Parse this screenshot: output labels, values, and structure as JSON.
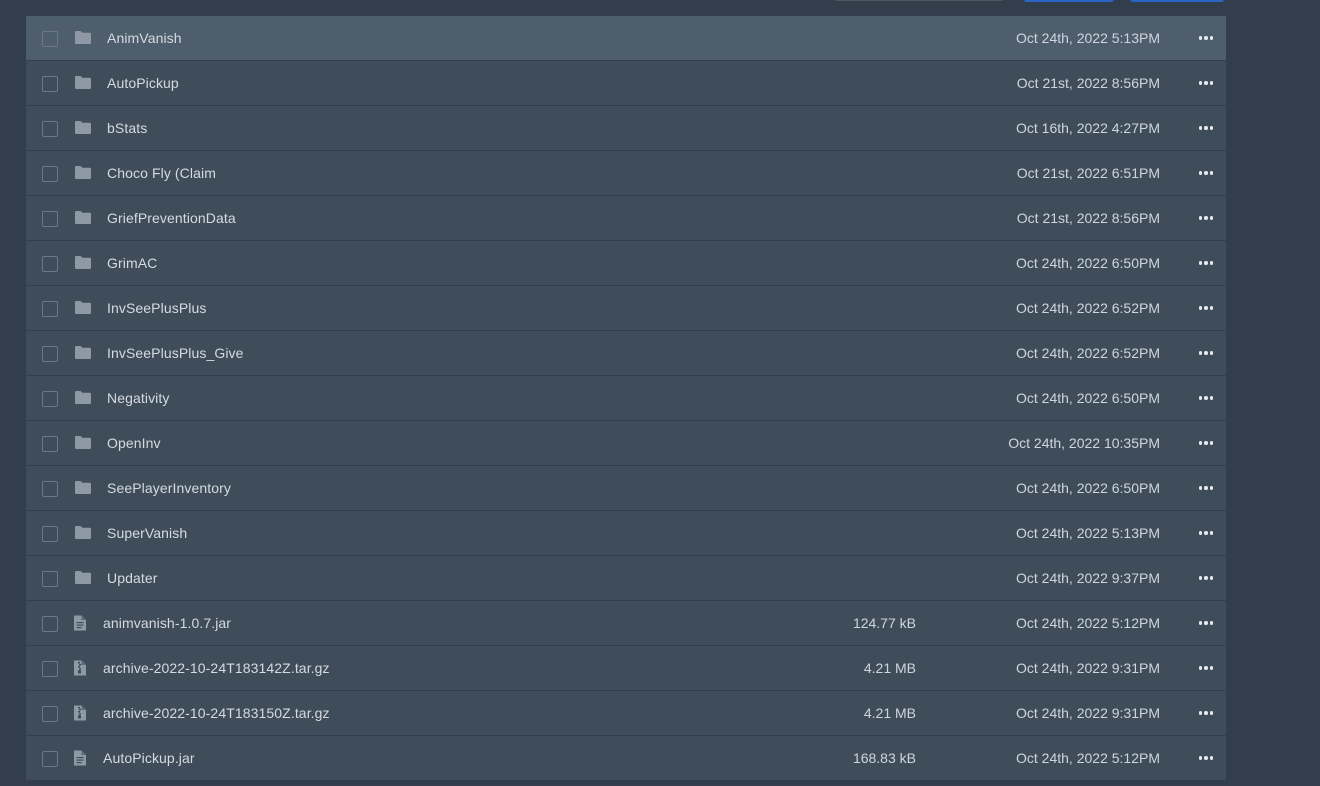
{
  "toolbar": {
    "primary_buttons": 2
  },
  "files": [
    {
      "type": "folder",
      "name": "AnimVanish",
      "size": "",
      "date": "Oct 24th, 2022 5:13PM"
    },
    {
      "type": "folder",
      "name": "AutoPickup",
      "size": "",
      "date": "Oct 21st, 2022 8:56PM"
    },
    {
      "type": "folder",
      "name": "bStats",
      "size": "",
      "date": "Oct 16th, 2022 4:27PM"
    },
    {
      "type": "folder",
      "name": "Choco Fly (Claim",
      "size": "",
      "date": "Oct 21st, 2022 6:51PM"
    },
    {
      "type": "folder",
      "name": "GriefPreventionData",
      "size": "",
      "date": "Oct 21st, 2022 8:56PM"
    },
    {
      "type": "folder",
      "name": "GrimAC",
      "size": "",
      "date": "Oct 24th, 2022 6:50PM"
    },
    {
      "type": "folder",
      "name": "InvSeePlusPlus",
      "size": "",
      "date": "Oct 24th, 2022 6:52PM"
    },
    {
      "type": "folder",
      "name": "InvSeePlusPlus_Give",
      "size": "",
      "date": "Oct 24th, 2022 6:52PM"
    },
    {
      "type": "folder",
      "name": "Negativity",
      "size": "",
      "date": "Oct 24th, 2022 6:50PM"
    },
    {
      "type": "folder",
      "name": "OpenInv",
      "size": "",
      "date": "Oct 24th, 2022 10:35PM"
    },
    {
      "type": "folder",
      "name": "SeePlayerInventory",
      "size": "",
      "date": "Oct 24th, 2022 6:50PM"
    },
    {
      "type": "folder",
      "name": "SuperVanish",
      "size": "",
      "date": "Oct 24th, 2022 5:13PM"
    },
    {
      "type": "folder",
      "name": "Updater",
      "size": "",
      "date": "Oct 24th, 2022 9:37PM"
    },
    {
      "type": "file",
      "name": "animvanish-1.0.7.jar",
      "size": "124.77 kB",
      "date": "Oct 24th, 2022 5:12PM"
    },
    {
      "type": "archive",
      "name": "archive-2022-10-24T183142Z.tar.gz",
      "size": "4.21 MB",
      "date": "Oct 24th, 2022 9:31PM"
    },
    {
      "type": "archive",
      "name": "archive-2022-10-24T183150Z.tar.gz",
      "size": "4.21 MB",
      "date": "Oct 24th, 2022 9:31PM"
    },
    {
      "type": "file",
      "name": "AutoPickup.jar",
      "size": "168.83 kB",
      "date": "Oct 24th, 2022 5:12PM"
    }
  ],
  "icons": {
    "folder": "folder-icon",
    "file": "file-text-icon",
    "archive": "file-archive-icon",
    "more": "more-horizontal-icon"
  },
  "colors": {
    "background": "#323e4b",
    "row": "#3f4d5a",
    "row_highlight": "#4f5e6d",
    "accent": "#2b63c6"
  }
}
